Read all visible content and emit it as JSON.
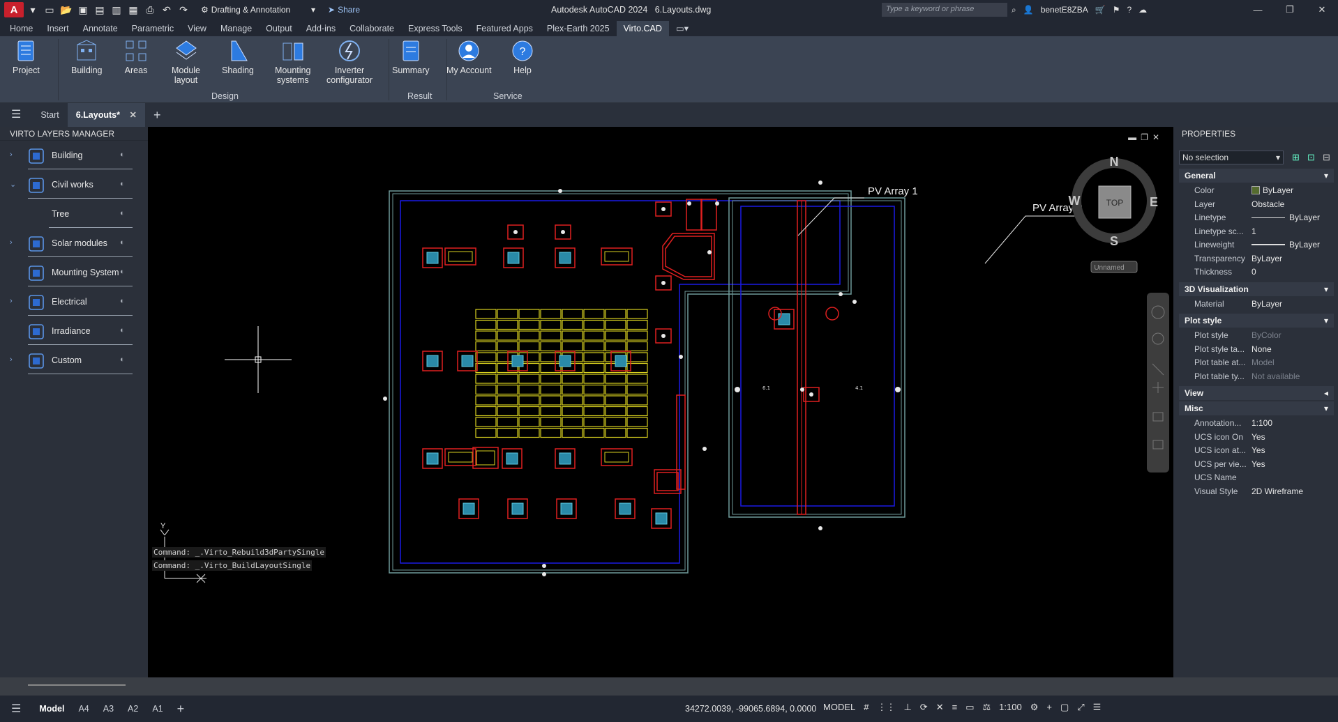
{
  "app": {
    "title": "Autodesk AutoCAD 2024",
    "file": "6.Layouts.dwg",
    "workspace": "Drafting & Annotation",
    "share_label": "Share",
    "search_placeholder": "Type a keyword or phrase",
    "user": "benetE8ZBA"
  },
  "menu_tabs": [
    "Home",
    "Insert",
    "Annotate",
    "Parametric",
    "View",
    "Manage",
    "Output",
    "Add-ins",
    "Collaborate",
    "Express Tools",
    "Featured Apps",
    "Plex-Earth 2025",
    "Virto.CAD"
  ],
  "active_menu_tab": "Virto.CAD",
  "ribbon": {
    "buttons": [
      {
        "label": "Project",
        "sub": ""
      },
      {
        "label": "Building",
        "sub": ""
      },
      {
        "label": "Areas",
        "sub": ""
      },
      {
        "label": "Module",
        "sub": "layout"
      },
      {
        "label": "Shading",
        "sub": ""
      },
      {
        "label": "Mounting",
        "sub": "systems"
      },
      {
        "label": "Inverter",
        "sub": "configurator"
      },
      {
        "label": "Summary",
        "sub": ""
      },
      {
        "label": "My Account",
        "sub": ""
      },
      {
        "label": "Help",
        "sub": ""
      }
    ],
    "groups": [
      "Design",
      "Result",
      "Service"
    ]
  },
  "doc_tabs": {
    "start": "Start",
    "active": "6.Layouts*"
  },
  "layers_manager": {
    "title": "VIRTO LAYERS MANAGER",
    "items": [
      {
        "label": "Building",
        "expandable": true
      },
      {
        "label": "Civil works",
        "expandable": true
      },
      {
        "label": "Tree",
        "expandable": false
      },
      {
        "label": "Solar modules",
        "expandable": true
      },
      {
        "label": "Mounting System",
        "expandable": false
      },
      {
        "label": "Electrical",
        "expandable": true
      },
      {
        "label": "Irradiance",
        "expandable": false
      },
      {
        "label": "Custom",
        "expandable": true
      }
    ]
  },
  "drawing": {
    "labels": {
      "array1": "PV Array 1",
      "array2": "PV Array 2"
    },
    "dim_a": "6.1",
    "dim_b": "4.1",
    "compass": {
      "n": "N",
      "s": "S",
      "e": "E",
      "w": "W",
      "top": "TOP",
      "ucs": "Unnamed"
    },
    "ucs_axis": "Y"
  },
  "properties": {
    "title": "PROPERTIES",
    "selection": "No selection",
    "sections": {
      "general": "General",
      "viz": "3D Visualization",
      "plot": "Plot style",
      "view": "View",
      "misc": "Misc"
    },
    "general": [
      {
        "k": "Color",
        "v": "ByLayer"
      },
      {
        "k": "Layer",
        "v": "Obstacle"
      },
      {
        "k": "Linetype",
        "v": "ByLayer"
      },
      {
        "k": "Linetype sc...",
        "v": "1"
      },
      {
        "k": "Lineweight",
        "v": "ByLayer"
      },
      {
        "k": "Transparency",
        "v": "ByLayer"
      },
      {
        "k": "Thickness",
        "v": "0"
      }
    ],
    "viz": [
      {
        "k": "Material",
        "v": "ByLayer"
      }
    ],
    "plot": [
      {
        "k": "Plot style",
        "v": "ByColor"
      },
      {
        "k": "Plot style ta...",
        "v": "None"
      },
      {
        "k": "Plot table at...",
        "v": "Model"
      },
      {
        "k": "Plot table ty...",
        "v": "Not available"
      }
    ],
    "misc": [
      {
        "k": "Annotation...",
        "v": "1:100"
      },
      {
        "k": "UCS icon On",
        "v": "Yes"
      },
      {
        "k": "UCS icon at...",
        "v": "Yes"
      },
      {
        "k": "UCS per vie...",
        "v": "Yes"
      },
      {
        "k": "UCS Name",
        "v": ""
      },
      {
        "k": "Visual Style",
        "v": "2D Wireframe"
      }
    ]
  },
  "command_history": [
    "Command: _.Virto_Rebuild3dPartySingle",
    "Command: _.Virto_BuildLayoutSingle"
  ],
  "status": {
    "layout_tabs": [
      "Model",
      "A4",
      "A3",
      "A2",
      "A1"
    ],
    "active": "Model",
    "coords": "34272.0039, -99065.6894, 0.0000",
    "mode": "MODEL",
    "scale": "1:100"
  },
  "colors": {
    "ribbon": "#3b4453",
    "accent": "#4a8fe0",
    "cad_red": "#e02020",
    "cad_blue": "#1a1ae6",
    "cad_yellow": "#d8d020",
    "cad_cyan": "#5ec8e0"
  }
}
